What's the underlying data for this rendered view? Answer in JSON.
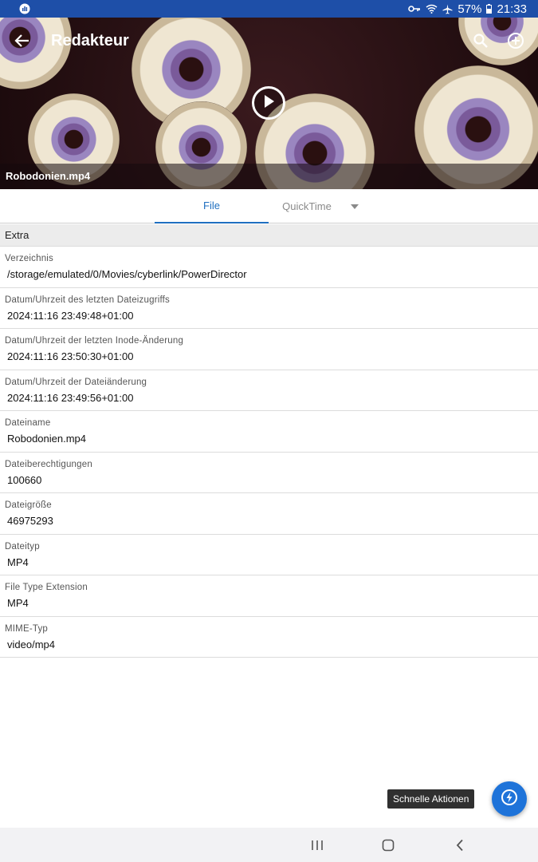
{
  "status_bar": {
    "battery": "57%",
    "time": "21:33",
    "icons": [
      "photo-icon",
      "key-icon",
      "wifi-icon",
      "airplane-icon",
      "battery-icon"
    ]
  },
  "app_bar": {
    "title": "Redakteur",
    "icons": [
      "back-arrow-icon",
      "search-icon",
      "add-circle-icon"
    ]
  },
  "video": {
    "file_name": "Robodonien.mp4",
    "icon": "play-icon"
  },
  "tabs": [
    {
      "label": "File",
      "active": true
    },
    {
      "label": "QuickTime",
      "active": false
    }
  ],
  "section": {
    "title": "Extra"
  },
  "rows": [
    {
      "label": "Verzeichnis",
      "value": "/storage/emulated/0/Movies/cyberlink/PowerDirector"
    },
    {
      "label": "Datum/Uhrzeit des letzten Dateizugriffs",
      "value": "2024:11:16 23:49:48+01:00"
    },
    {
      "label": "Datum/Uhrzeit der letzten Inode-Änderung",
      "value": "2024:11:16 23:50:30+01:00"
    },
    {
      "label": "Datum/Uhrzeit der Dateiänderung",
      "value": "2024:11:16 23:49:56+01:00"
    },
    {
      "label": "Dateiname",
      "value": "Robodonien.mp4"
    },
    {
      "label": "Dateiberechtigungen",
      "value": "100660"
    },
    {
      "label": "Dateigröße",
      "value": "46975293"
    },
    {
      "label": "Dateityp",
      "value": "MP4"
    },
    {
      "label": "File Type Extension",
      "value": "MP4"
    },
    {
      "label": "MIME-Typ",
      "value": "video/mp4"
    }
  ],
  "quick_actions": {
    "tooltip": "Schnelle Aktionen",
    "icon": "bolt-icon"
  },
  "nav_bar": {
    "icons": [
      "recents-icon",
      "home-icon",
      "back-icon"
    ]
  },
  "colors": {
    "status_bar": "#1e4fa8",
    "accent": "#1f6fc0",
    "fab": "#1e73d9"
  }
}
